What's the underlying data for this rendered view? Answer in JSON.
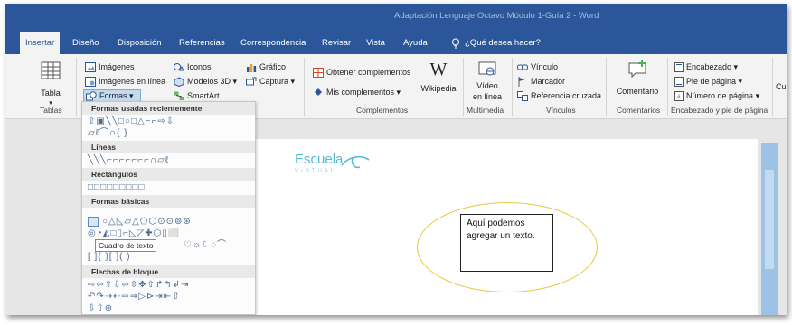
{
  "window": {
    "title": "Adaptación Lenguaje Octavo Módulo 1-Guía 2  -  Word"
  },
  "tabs": [
    {
      "label": "Insertar",
      "active": true
    },
    {
      "label": "Diseño"
    },
    {
      "label": "Disposición"
    },
    {
      "label": "Referencias"
    },
    {
      "label": "Correspondencia"
    },
    {
      "label": "Revisar"
    },
    {
      "label": "Vista"
    },
    {
      "label": "Ayuda"
    },
    {
      "label": "¿Qué desea hacer?"
    }
  ],
  "ribbon": {
    "tablas": {
      "button": "Tabla",
      "label": "Tablas"
    },
    "ilustraciones": {
      "imagenes": "Imágenes",
      "imagenes_linea": "Imágenes en línea",
      "formas": "Formas",
      "iconos": "Iconos",
      "modelos3d": "Modelos 3D",
      "smartart": "SmartArt",
      "grafico": "Gráfico",
      "captura": "Captura"
    },
    "complementos": {
      "obtener": "Obtener complementos",
      "mis": "Mis complementos",
      "wikipedia": "Wikipedia",
      "label": "Complementos"
    },
    "multimedia": {
      "video_line1": "Vídeo",
      "video_line2": "en línea",
      "label": "Multimedia"
    },
    "vinculos": {
      "vinculo": "Vínculo",
      "marcador": "Marcador",
      "referencia": "Referencia cruzada",
      "label": "Vínculos"
    },
    "comentarios": {
      "comentario": "Comentario",
      "label": "Comentarios"
    },
    "encabezado": {
      "encabezado": "Encabezado",
      "pie": "Pie de página",
      "numero": "Número de página",
      "label": "Encabezado y pie de página"
    },
    "cut_off": "Cu"
  },
  "shapes_panel": {
    "sections": [
      {
        "title": "Formas usadas recientemente"
      },
      {
        "title": "Líneas"
      },
      {
        "title": "Rectángulos"
      },
      {
        "title": "Formas básicas"
      },
      {
        "title": "Flechas de bloque"
      }
    ],
    "tooltip": "Cuadro de texto"
  },
  "document": {
    "logo_word": "Escuela",
    "logo_sub": "VIRTUAL",
    "textbox_text": "Aquí podemos agregar un texto."
  },
  "colors": {
    "title_bar": "#2b579a",
    "ellipse_outline": "#e8c845",
    "logo": "#55b9d8",
    "scrollbar": "#9cc3e6"
  }
}
